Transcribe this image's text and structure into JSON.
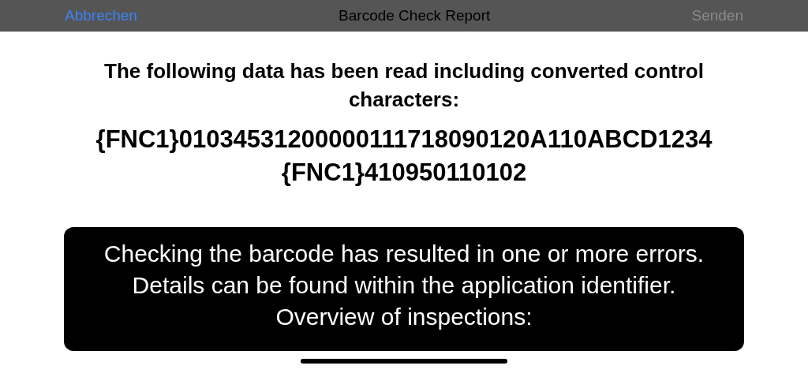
{
  "nav_bar": {
    "cancel": "Abbrechen",
    "title": "Barcode Check Report",
    "send": {
      "label": "Senden",
      "disabled": true
    }
  },
  "heading": "The following data has been read including converted control characters:",
  "data_string": "{FNC1}01034531200000111718090120A110ABCD1234{FNC1}410950110102",
  "error_message": "Checking the barcode has resulted in one or more errors. Details can be found within the application identifier. Overview of inspections:"
}
